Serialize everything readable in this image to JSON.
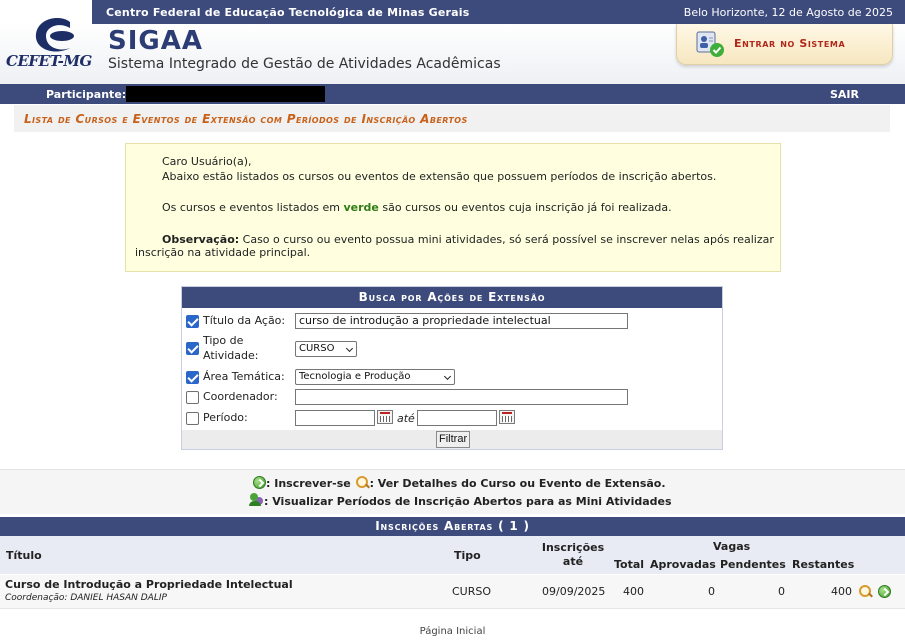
{
  "header": {
    "institution": "Centro Federal de Educação Tecnológica de Minas Gerais",
    "date": "Belo Horizonte, 12 de Agosto de 2025",
    "logo_text": "CEFET-MG",
    "app_name": "SIGAA",
    "app_subtitle": "Sistema Integrado de Gestão de Atividades Acadêmicas",
    "login_label": "Entrar no Sistema"
  },
  "participant_bar": {
    "label": "Participante:",
    "logout_label": "SAIR"
  },
  "page_title": "Lista de Cursos e Eventos de Extensão com Períodos de Inscrição Abertos",
  "info": {
    "greeting": "Caro Usuário(a),",
    "line1": "Abaixo estão listados os cursos ou eventos de extensão que possuem períodos de inscrição abertos.",
    "line2_before": "Os cursos e eventos listados em ",
    "line2_highlight": "verde",
    "line2_after": " são cursos ou eventos cuja inscrição já foi realizada.",
    "obs_label": "Observação:",
    "obs_text": " Caso o curso ou evento possua mini atividades, só será possível se inscrever nelas após realizar",
    "obs_text2": "inscrição na atividade principal."
  },
  "search": {
    "title": "Busca por Ações de Extensão",
    "titulo_label": "Título da Ação:",
    "titulo_value": "curso de introdução a propriedade intelectual",
    "tipo_label_1": "Tipo de",
    "tipo_label_2": "Atividade:",
    "tipo_value": "CURSO",
    "area_label": "Área Temática:",
    "area_value": "Tecnologia e Produção",
    "coord_label": "Coordenador:",
    "coord_value": "",
    "periodo_label": "Período:",
    "ate_label": "até",
    "filter_button": "Filtrar"
  },
  "legend": {
    "inscrever": ": Inscrever-se",
    "detalhes": ": Ver Detalhes do Curso ou Evento de Extensão.",
    "mini": ": Visualizar Períodos de Inscrição Abertos para as Mini Atividades"
  },
  "results": {
    "title": "Inscrições Abertas ( 1 )",
    "columns": {
      "titulo": "Título",
      "tipo": "Tipo",
      "inscricoes_1": "Inscrições",
      "inscricoes_2": "até",
      "vagas": "Vagas",
      "total": "Total",
      "aprovadas": "Aprovadas",
      "pendentes": "Pendentes",
      "restantes": "Restantes"
    },
    "rows": [
      {
        "titulo": "Curso de Introdução a Propriedade Intelectual",
        "coordenacao": "Coordenação: DANIEL HASAN DALIP",
        "tipo": "CURSO",
        "inscricoes_ate": "09/09/2025",
        "total": "400",
        "aprovadas": "0",
        "pendentes": "0",
        "restantes": "400"
      }
    ]
  },
  "footer": {
    "home_link": "Página Inicial"
  },
  "icons": [
    "cefet-logo-icon",
    "login-user-icon",
    "calendar-icon",
    "go-icon",
    "magnifier-icon",
    "people-icon"
  ]
}
